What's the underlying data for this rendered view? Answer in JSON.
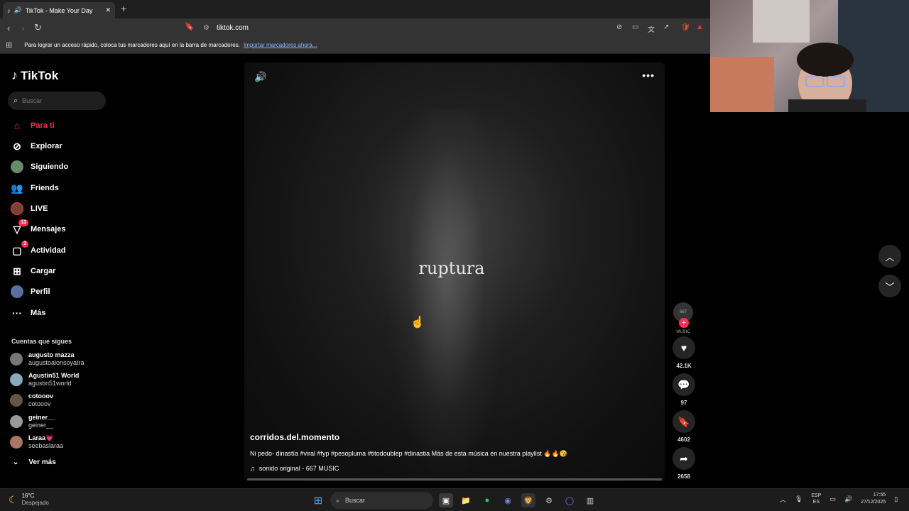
{
  "browser": {
    "tab_title": "TikTok - Make Your Day",
    "url": "tiktok.com",
    "bookmarks_text": "Para lograr un acceso rápido, coloca tus marcadores aquí en la barra de marcadores.",
    "bookmarks_link": "Importar marcadores ahora..."
  },
  "sidebar": {
    "logo": "TikTok",
    "search_placeholder": "Buscar",
    "nav": [
      {
        "label": "Para ti",
        "active": true
      },
      {
        "label": "Explorar"
      },
      {
        "label": "Siguiendo"
      },
      {
        "label": "Friends"
      },
      {
        "label": "LIVE"
      },
      {
        "label": "Mensajes",
        "badge": "13"
      },
      {
        "label": "Actividad",
        "badge": "3"
      },
      {
        "label": "Cargar"
      },
      {
        "label": "Perfil"
      },
      {
        "label": "Más"
      }
    ],
    "following_title": "Cuentas que sigues",
    "following": [
      {
        "name": "augusto mazza",
        "handle": "augustoalonsoyatra"
      },
      {
        "name": "Agustin51 World",
        "handle": "agustin51world"
      },
      {
        "name": "cotooov",
        "handle": "cotooov"
      },
      {
        "name": "geiner__",
        "handle": "geiner__"
      },
      {
        "name": "Laraa💗",
        "handle": "seebaslaraa"
      }
    ],
    "see_more": "Ver más"
  },
  "video": {
    "overlay_text": "ruptura",
    "author": "corridos.del.momento",
    "description": "Ni pedo- dinastía #viral #fyp #pesopluma #titodoublep #dinastia Más de esta música en nuestra playlist 🔥🔥😘",
    "music": "sonido original - 667 MUSIC",
    "progress": 0.0,
    "avatar_text": "667 MUSIC",
    "likes": "42.1K",
    "comments": "97",
    "saves": "4602",
    "shares": "2658"
  },
  "taskbar": {
    "temp": "16°C",
    "weather": "Despejado",
    "search": "Buscar",
    "lang_top": "ESP",
    "lang_bottom": "ES",
    "time": "17:55",
    "date": "27/12/2025"
  },
  "colors": {
    "accent": "#fe2c55"
  }
}
